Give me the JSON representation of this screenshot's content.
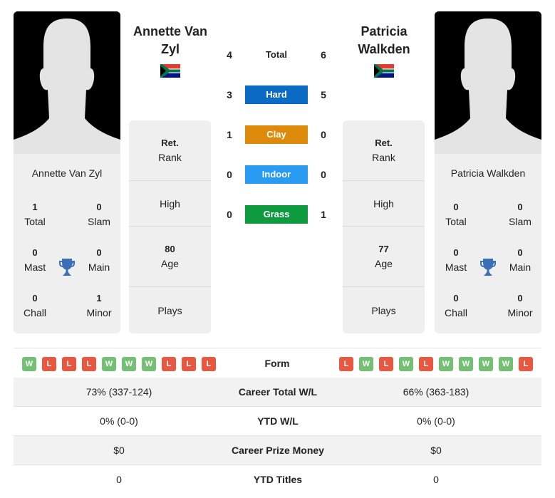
{
  "players": [
    {
      "name": "Annette Van Zyl",
      "card_name": "Annette Van Zyl",
      "country_flag": "south-africa-flag",
      "titles": {
        "total": {
          "value": "1",
          "label": "Total"
        },
        "slam": {
          "value": "0",
          "label": "Slam"
        },
        "mast": {
          "value": "0",
          "label": "Mast"
        },
        "main": {
          "value": "0",
          "label": "Main"
        },
        "chall": {
          "value": "0",
          "label": "Chall"
        },
        "minor": {
          "value": "1",
          "label": "Minor"
        }
      },
      "info": {
        "rank_value": "Ret.",
        "rank_label": "Rank",
        "high_label": "High",
        "age_value": "80",
        "age_label": "Age",
        "plays_label": "Plays"
      },
      "form": [
        "W",
        "L",
        "L",
        "L",
        "W",
        "W",
        "W",
        "L",
        "L",
        "L"
      ]
    },
    {
      "name": "Patricia Walkden",
      "card_name": "Patricia Walkden",
      "country_flag": "south-africa-flag",
      "titles": {
        "total": {
          "value": "0",
          "label": "Total"
        },
        "slam": {
          "value": "0",
          "label": "Slam"
        },
        "mast": {
          "value": "0",
          "label": "Mast"
        },
        "main": {
          "value": "0",
          "label": "Main"
        },
        "chall": {
          "value": "0",
          "label": "Chall"
        },
        "minor": {
          "value": "0",
          "label": "Minor"
        }
      },
      "info": {
        "rank_value": "Ret.",
        "rank_label": "Rank",
        "high_label": "High",
        "age_value": "77",
        "age_label": "Age",
        "plays_label": "Plays"
      },
      "form": [
        "L",
        "W",
        "L",
        "W",
        "L",
        "W",
        "W",
        "W",
        "W",
        "L"
      ]
    }
  ],
  "head_to_head": [
    {
      "label": "Total",
      "left": "4",
      "right": "6",
      "color": null
    },
    {
      "label": "Hard",
      "left": "3",
      "right": "5",
      "color": "#0a6ac4"
    },
    {
      "label": "Clay",
      "left": "1",
      "right": "0",
      "color": "#dd8a0a"
    },
    {
      "label": "Indoor",
      "left": "0",
      "right": "0",
      "color": "#2a9bf2"
    },
    {
      "label": "Grass",
      "left": "0",
      "right": "1",
      "color": "#0e9a3e"
    }
  ],
  "form_label": "Form",
  "stats": [
    {
      "label": "Career Total W/L",
      "left": "73% (337-124)",
      "right": "66% (363-183)"
    },
    {
      "label": "YTD W/L",
      "left": "0% (0-0)",
      "right": "0% (0-0)"
    },
    {
      "label": "Career Prize Money",
      "left": "$0",
      "right": "$0"
    },
    {
      "label": "YTD Titles",
      "left": "0",
      "right": "0"
    }
  ],
  "colors": {
    "win": "#73bf73",
    "loss": "#e8573f",
    "trophy": "#3a6fb8"
  }
}
